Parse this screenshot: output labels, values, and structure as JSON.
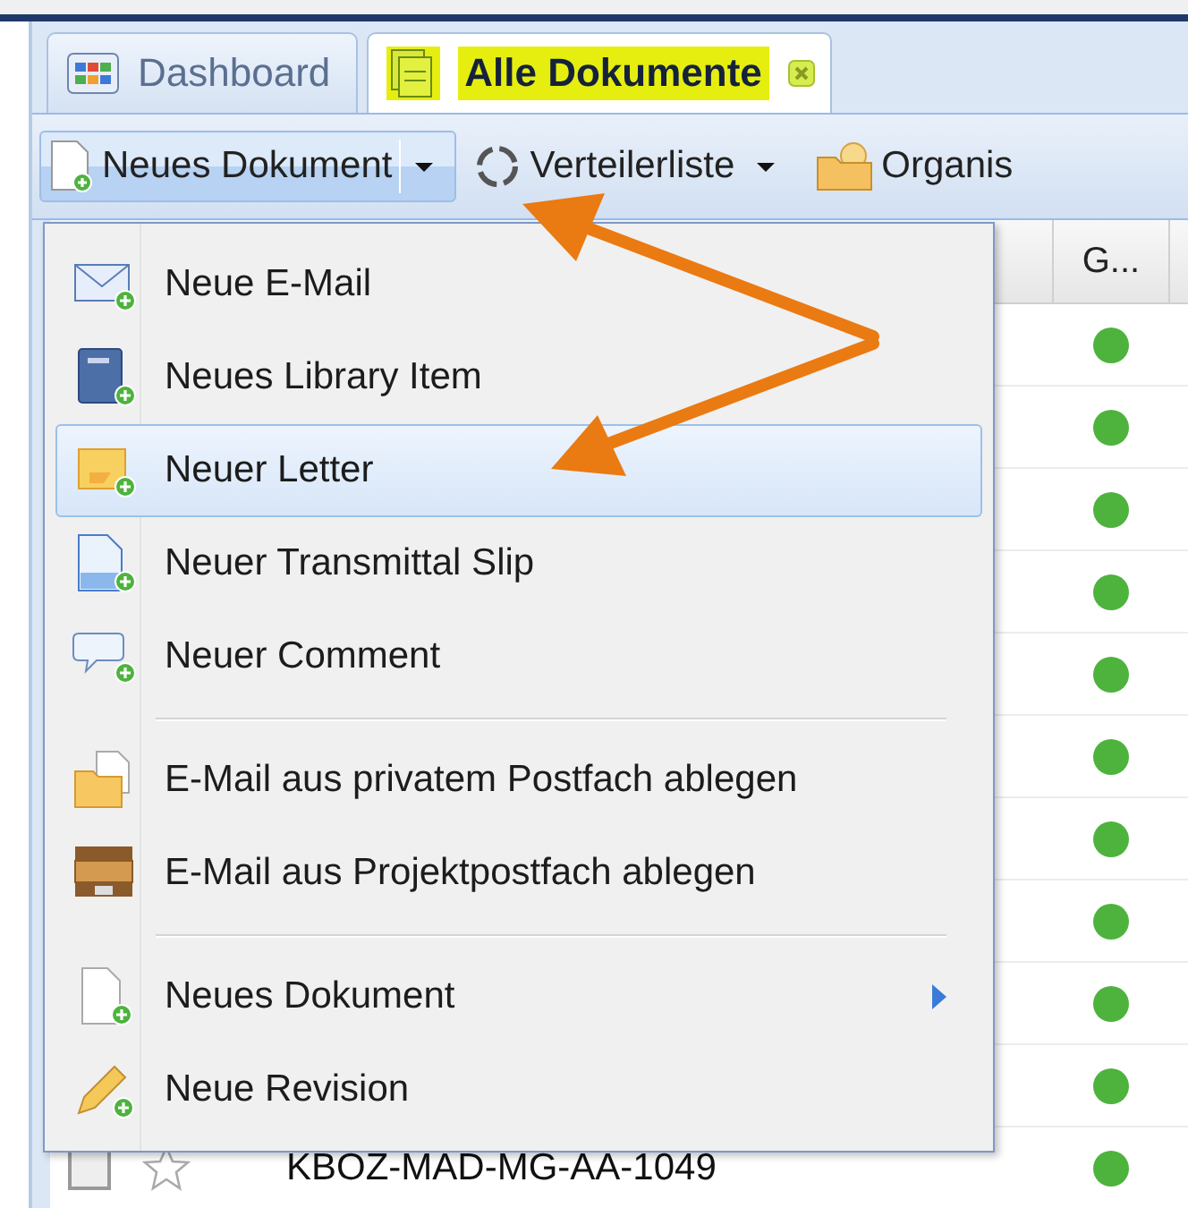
{
  "tabs": [
    {
      "label": "Dashboard",
      "selected": false
    },
    {
      "label": "Alle Dokumente",
      "selected": true,
      "closable": true
    }
  ],
  "toolbar": [
    {
      "label": "Neues Dokument",
      "kind": "split",
      "pressed": true
    },
    {
      "label": "Verteilerliste",
      "kind": "split",
      "pressed": false
    },
    {
      "label": "Organis",
      "kind": "button",
      "pressed": false
    }
  ],
  "grid": {
    "columns": [
      {
        "label": "G..."
      }
    ],
    "rows": [
      {
        "color": "#4db33d"
      },
      {
        "color": "#4db33d"
      },
      {
        "color": "#4db33d"
      },
      {
        "color": "#4db33d"
      },
      {
        "color": "#4db33d"
      },
      {
        "color": "#4db33d"
      },
      {
        "color": "#4db33d"
      },
      {
        "color": "#4db33d"
      },
      {
        "color": "#4db33d"
      },
      {
        "color": "#4db33d"
      },
      {
        "color": "#4db33d",
        "checked": false,
        "starred": false,
        "name": "KBOZ-MAD-MG-AA-1049"
      }
    ]
  },
  "menu": [
    {
      "kind": "item",
      "label": "Neue E-Mail",
      "selected": false
    },
    {
      "kind": "item",
      "label": "Neues Library Item",
      "selected": false
    },
    {
      "kind": "item",
      "label": "Neuer Letter",
      "selected": true
    },
    {
      "kind": "item",
      "label": "Neuer Transmittal Slip",
      "selected": false
    },
    {
      "kind": "item",
      "label": "Neuer Comment",
      "selected": false
    },
    {
      "kind": "separator"
    },
    {
      "kind": "item",
      "label": "E-Mail aus privatem Postfach ablegen",
      "selected": false
    },
    {
      "kind": "item",
      "label": "E-Mail aus Projektpostfach ablegen",
      "selected": false
    },
    {
      "kind": "separator"
    },
    {
      "kind": "submenu",
      "label": "Neues Dokument",
      "selected": false
    },
    {
      "kind": "item",
      "label": "Neue Revision",
      "selected": false
    }
  ]
}
